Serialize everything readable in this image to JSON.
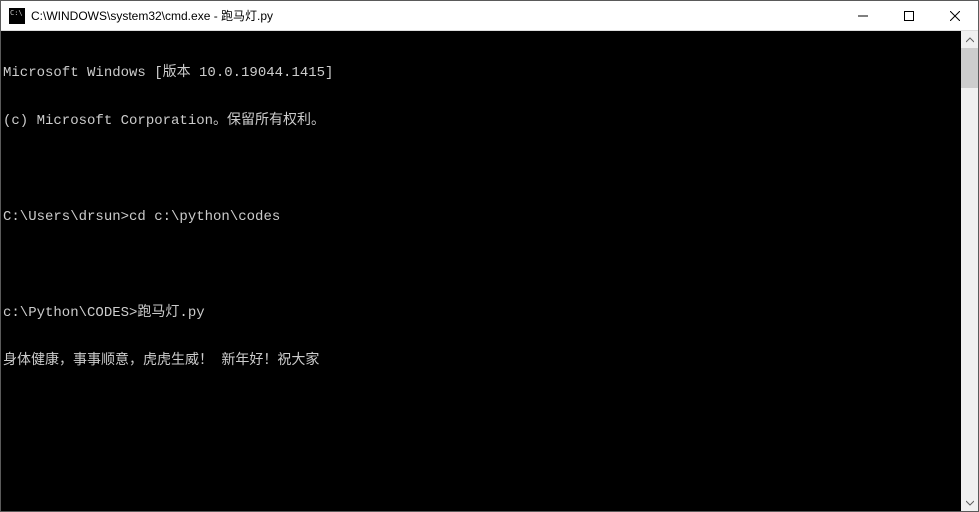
{
  "window": {
    "title": "C:\\WINDOWS\\system32\\cmd.exe - 跑马灯.py"
  },
  "terminal": {
    "lines": [
      "Microsoft Windows [版本 10.0.19044.1415]",
      "(c) Microsoft Corporation。保留所有权利。",
      "",
      "C:\\Users\\drsun>cd c:\\python\\codes",
      "",
      "c:\\Python\\CODES>跑马灯.py",
      "身体健康，事事顺意，虎虎生威！ 新年好！祝大家"
    ]
  }
}
